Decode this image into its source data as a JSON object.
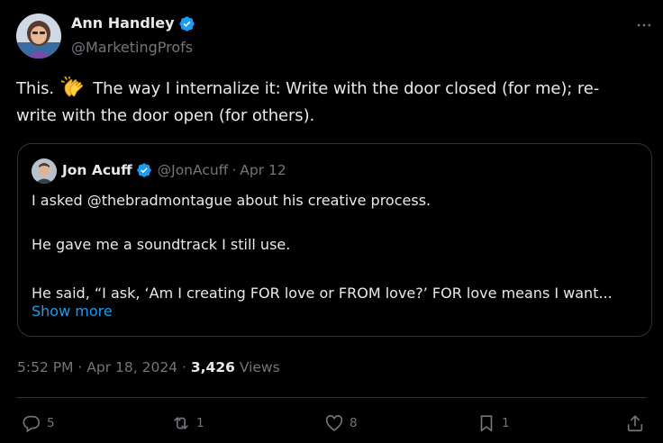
{
  "author": {
    "name": "Ann Handley",
    "handle": "@MarketingProfs",
    "verified": true
  },
  "tweet": {
    "text_part1": "This.",
    "emoji": "clapping-hands",
    "text_part2": "The way I internalize it: Write with the door closed (for me); re-",
    "text_line2": "write with the door open (for others)."
  },
  "quote": {
    "name": "Jon Acuff",
    "handle": "@JonAcuff",
    "separator": "·",
    "date": "Apr 12",
    "line1": "I asked @thebradmontague about his creative process.",
    "line2": "He gave me a soundtrack I still use.",
    "line3": "He said, “I ask, ‘Am I creating FOR love or FROM love?’ FOR love means I want...",
    "show_more": "Show more"
  },
  "meta": {
    "time": "5:52 PM",
    "sep1": "·",
    "date": "Apr 18, 2024",
    "sep2": "·",
    "views_count": "3,426",
    "views_label": "Views"
  },
  "actions": {
    "replies": "5",
    "reposts": "1",
    "likes": "8",
    "bookmarks": "1"
  },
  "colors": {
    "background": "#000000",
    "text": "#e7e9ea",
    "muted": "#71767b",
    "accent": "#1d9bf0",
    "border": "#2f3336"
  }
}
